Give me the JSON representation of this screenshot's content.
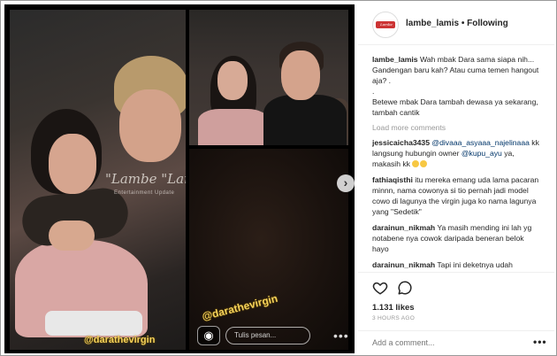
{
  "header": {
    "avatar_text": "Lambe Lamis",
    "username": "lambe_lamis",
    "separator": " • ",
    "follow_state": "Following"
  },
  "photos": {
    "watermark": "\"Lambe \"Lamis\"",
    "watermark_sub": "Entertainment  Update",
    "tag_main": "@darathevirgin",
    "tag_bottom": "@darathevirgin",
    "compose_placeholder": "Tulis pesan...",
    "more": "•••",
    "next": "›",
    "camera": "◉"
  },
  "caption": {
    "user": "lambe_lamis",
    "text": "Wah mbak Dara sama siapa nih... Gandengan baru kah? Atau cuma temen hangout aja? .",
    "dot": ".",
    "text2": "Betewe mbak Dara tambah dewasa ya sekarang, tambah cantik"
  },
  "load_more": "Load more comments",
  "comments": [
    {
      "user": "jessicaicha3435",
      "mention1": "@divaaa_asyaaa_najelinaaa",
      "text1": "kk langsung hubungin owner",
      "mention2": "@kupu_ayu",
      "text2": "ya, makasih kk"
    },
    {
      "user": "fathiaqisthi",
      "text": "itu mereka emang uda lama pacaran minnn, nama cowonya si tio pernah jadi model cowo di lagunya the virgin juga ko nama lagunya yang \"Sedetik\""
    },
    {
      "user": "darainun_nikmah",
      "text": "Ya masih mending ini lah yg notabene nya cowok daripada beneran belok hayo"
    },
    {
      "user": "darainun_nikmah",
      "text": "Tapi ini deketnya udah"
    }
  ],
  "likes": "1.131 likes",
  "time": "3 HOURS AGO",
  "add_comment": {
    "placeholder": "Add a comment...",
    "more": "•••"
  },
  "colors": {
    "accent_link": "#003569",
    "tag_yellow": "#f4d15a"
  }
}
